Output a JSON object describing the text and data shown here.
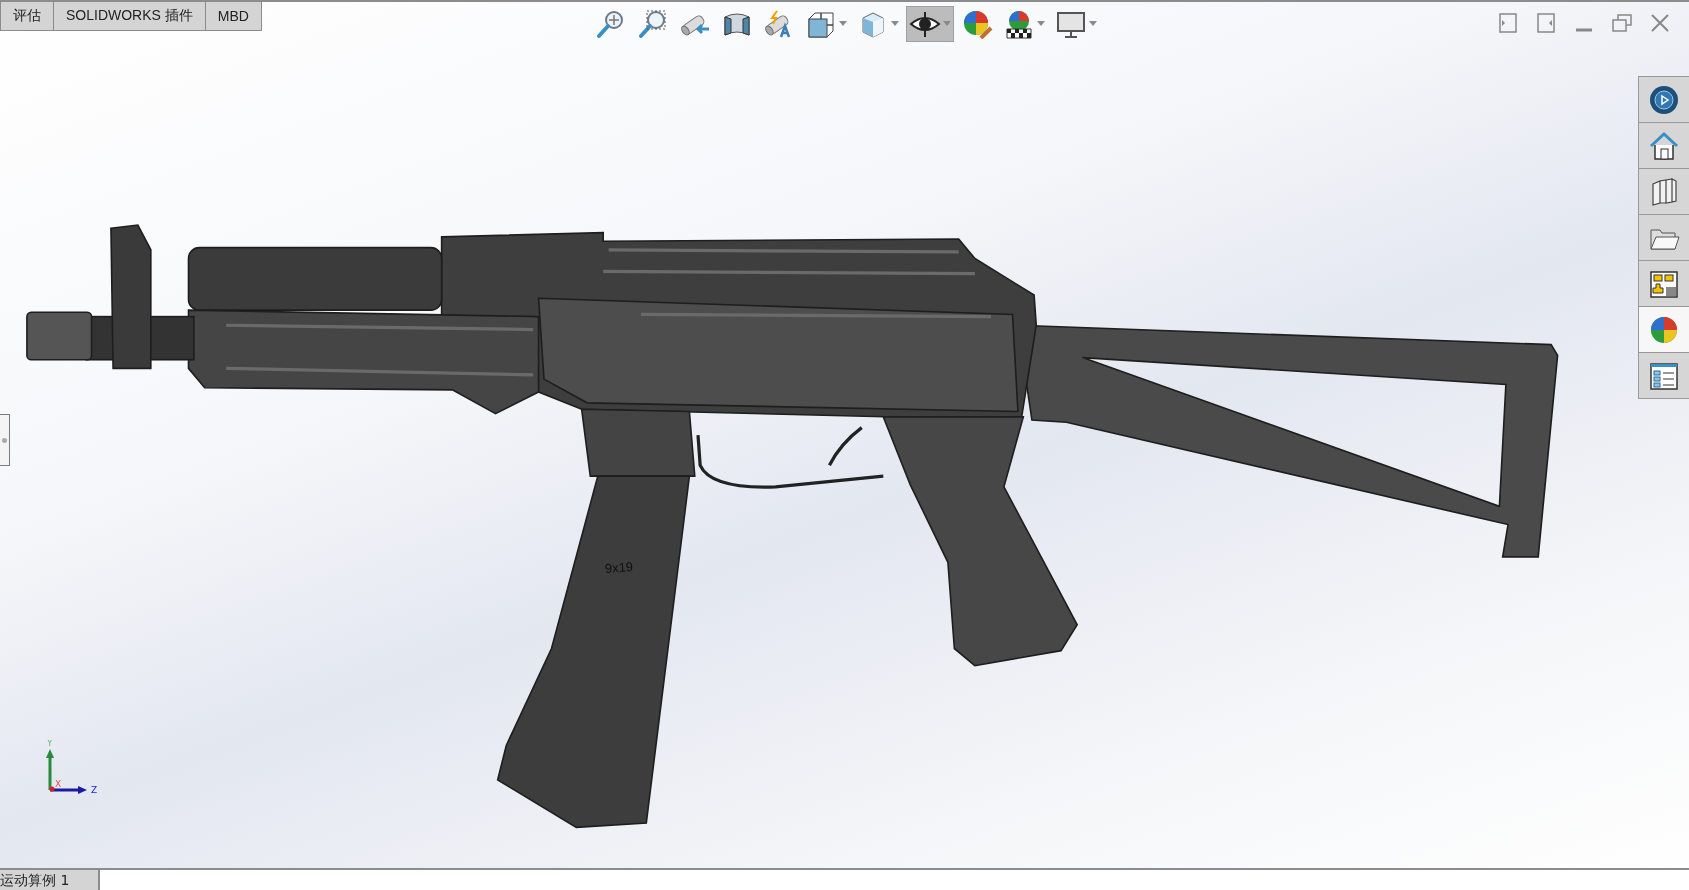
{
  "ribbon_tabs": [
    {
      "label": "评估",
      "selected": false
    },
    {
      "label": "SOLIDWORKS 插件",
      "selected": false
    },
    {
      "label": "MBD",
      "selected": false
    }
  ],
  "view_toolbar": [
    {
      "pressed": false,
      "dropdown": false
    },
    {
      "pressed": false,
      "dropdown": false
    },
    {
      "pressed": false,
      "dropdown": false
    },
    {
      "pressed": false,
      "dropdown": false
    },
    {
      "pressed": false,
      "dropdown": false
    },
    {
      "pressed": false,
      "dropdown": true
    },
    {
      "pressed": false,
      "dropdown": true
    },
    {
      "pressed": true,
      "dropdown": true
    },
    {
      "pressed": false,
      "dropdown": false
    },
    {
      "pressed": false,
      "dropdown": true
    },
    {
      "pressed": false,
      "dropdown": true
    }
  ],
  "task_pane_tabs": [
    {
      "selected": false
    },
    {
      "selected": false
    },
    {
      "selected": false
    },
    {
      "selected": false
    },
    {
      "selected": false
    },
    {
      "selected": true
    },
    {
      "selected": false
    }
  ],
  "model": {
    "marking": "9x19"
  },
  "triad": {
    "y": "Y",
    "x": "X",
    "z": "Z"
  },
  "status_bar": {
    "study_tab": "运动算例 1"
  }
}
